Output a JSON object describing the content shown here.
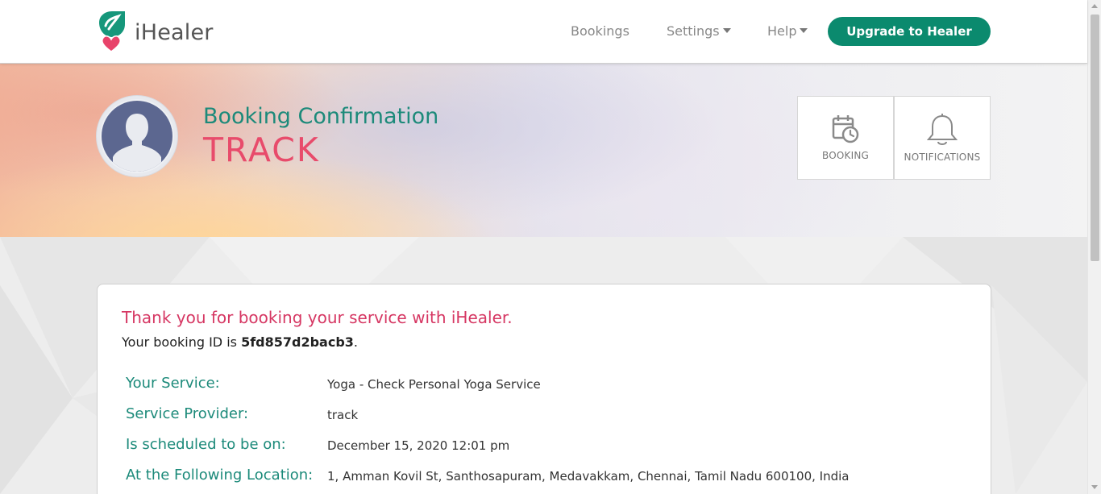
{
  "app": {
    "name": "iHealer"
  },
  "nav": {
    "links": [
      {
        "label": "Bookings",
        "has_dropdown": false
      },
      {
        "label": "Settings",
        "has_dropdown": true
      },
      {
        "label": "Help",
        "has_dropdown": true
      }
    ],
    "upgrade_label": "Upgrade to Healer"
  },
  "hero": {
    "subtitle": "Booking Confirmation",
    "title": "TRACK",
    "tiles": [
      {
        "label": "BOOKING",
        "icon": "calendar-clock-icon"
      },
      {
        "label": "NOTIFICATIONS",
        "icon": "bell-icon"
      }
    ]
  },
  "confirmation": {
    "thanks": "Thank you for booking your service with iHealer.",
    "booking_id_prefix": "Your booking ID is ",
    "booking_id": "5fd857d2bacb3",
    "booking_id_suffix": ".",
    "details": [
      {
        "label": "Your Service:",
        "value": "Yoga - Check Personal Yoga Service"
      },
      {
        "label": "Service Provider:",
        "value": "track"
      },
      {
        "label": "Is scheduled to be on:",
        "value": "December 15, 2020 12:01 pm"
      },
      {
        "label": "At the Following Location:",
        "value": "1, Amman Kovil St, Santhosapuram, Medavakkam, Chennai, Tamil Nadu 600100, India"
      }
    ]
  },
  "colors": {
    "brand_green": "#0b8a6e",
    "heading_teal": "#1c8a7a",
    "accent_pink": "#e84b6b",
    "thanks_pink": "#d63763"
  }
}
